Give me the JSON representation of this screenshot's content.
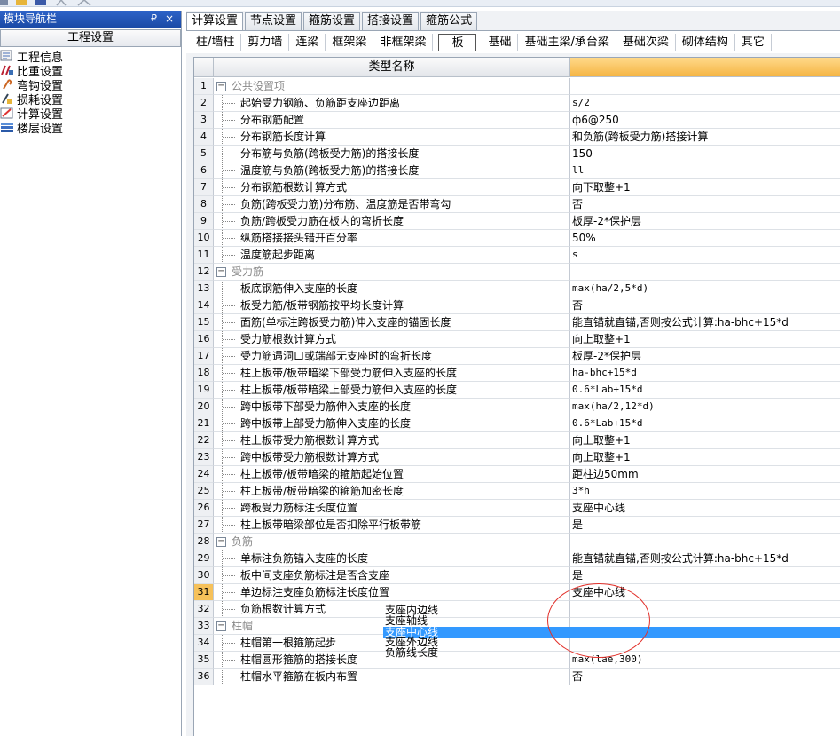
{
  "navigator": {
    "title": "模块导航栏",
    "pin_glyph": "₽",
    "close_glyph": "×",
    "header": "工程设置",
    "items": [
      {
        "label": "工程信息",
        "icon": "info-icon"
      },
      {
        "label": "比重设置",
        "icon": "rebar-icon"
      },
      {
        "label": "弯钩设置",
        "icon": "hook-icon"
      },
      {
        "label": "损耗设置",
        "icon": "loss-icon"
      },
      {
        "label": "计算设置",
        "icon": "calc-icon"
      },
      {
        "label": "楼层设置",
        "icon": "floor-icon"
      }
    ]
  },
  "tabs": [
    "计算设置",
    "节点设置",
    "箍筋设置",
    "搭接设置",
    "箍筋公式"
  ],
  "active_tab": 0,
  "subtabs": [
    "柱/墙柱",
    "剪力墙",
    "连梁",
    "框架梁",
    "非框架梁",
    "板",
    "基础",
    "基础主梁/承台梁",
    "基础次梁",
    "砌体结构",
    "其它"
  ],
  "active_subtab": 5,
  "grid": {
    "header_name": "类型名称",
    "rows": [
      {
        "n": "1",
        "name": "公共设置项",
        "value": "",
        "group": true
      },
      {
        "n": "2",
        "name": "起始受力钢筋、负筋距支座边距离",
        "value": "s/2"
      },
      {
        "n": "3",
        "name": "分布钢筋配置",
        "value": "ф6@250"
      },
      {
        "n": "4",
        "name": "分布钢筋长度计算",
        "value": "和负筋(跨板受力筋)搭接计算"
      },
      {
        "n": "5",
        "name": "分布筋与负筋(跨板受力筋)的搭接长度",
        "value": "150"
      },
      {
        "n": "6",
        "name": "温度筋与负筋(跨板受力筋)的搭接长度",
        "value": "ll"
      },
      {
        "n": "7",
        "name": "分布钢筋根数计算方式",
        "value": "向下取整+1"
      },
      {
        "n": "8",
        "name": "负筋(跨板受力筋)分布筋、温度筋是否带弯勾",
        "value": "否"
      },
      {
        "n": "9",
        "name": "负筋/跨板受力筋在板内的弯折长度",
        "value": "板厚-2*保护层"
      },
      {
        "n": "10",
        "name": "纵筋搭接接头错开百分率",
        "value": "50%"
      },
      {
        "n": "11",
        "name": "温度筋起步距离",
        "value": "s"
      },
      {
        "n": "12",
        "name": "受力筋",
        "value": "",
        "group": true
      },
      {
        "n": "13",
        "name": "板底钢筋伸入支座的长度",
        "value": "max(ha/2,5*d)"
      },
      {
        "n": "14",
        "name": "板受力筋/板带钢筋按平均长度计算",
        "value": "否"
      },
      {
        "n": "15",
        "name": "面筋(单标注跨板受力筋)伸入支座的锚固长度",
        "value": "能直锚就直锚,否则按公式计算:ha-bhc+15*d"
      },
      {
        "n": "16",
        "name": "受力筋根数计算方式",
        "value": "向上取整+1"
      },
      {
        "n": "17",
        "name": "受力筋遇洞口或端部无支座时的弯折长度",
        "value": "板厚-2*保护层"
      },
      {
        "n": "18",
        "name": "柱上板带/板带暗梁下部受力筋伸入支座的长度",
        "value": "ha-bhc+15*d"
      },
      {
        "n": "19",
        "name": "柱上板带/板带暗梁上部受力筋伸入支座的长度",
        "value": "0.6*Lab+15*d"
      },
      {
        "n": "20",
        "name": "跨中板带下部受力筋伸入支座的长度",
        "value": "max(ha/2,12*d)"
      },
      {
        "n": "21",
        "name": "跨中板带上部受力筋伸入支座的长度",
        "value": "0.6*Lab+15*d"
      },
      {
        "n": "22",
        "name": "柱上板带受力筋根数计算方式",
        "value": "向上取整+1"
      },
      {
        "n": "23",
        "name": "跨中板带受力筋根数计算方式",
        "value": "向上取整+1"
      },
      {
        "n": "24",
        "name": "柱上板带/板带暗梁的箍筋起始位置",
        "value": "距柱边50mm"
      },
      {
        "n": "25",
        "name": "柱上板带/板带暗梁的箍筋加密长度",
        "value": "3*h"
      },
      {
        "n": "26",
        "name": "跨板受力筋标注长度位置",
        "value": "支座中心线"
      },
      {
        "n": "27",
        "name": "柱上板带暗梁部位是否扣除平行板带筋",
        "value": "是"
      },
      {
        "n": "28",
        "name": "负筋",
        "value": "",
        "group": true
      },
      {
        "n": "29",
        "name": "单标注负筋锚入支座的长度",
        "value": "能直锚就直锚,否则按公式计算:ha-bhc+15*d"
      },
      {
        "n": "30",
        "name": "板中间支座负筋标注是否含支座",
        "value": "是"
      },
      {
        "n": "31",
        "name": "单边标注支座负筋标注长度位置",
        "value": "支座中心线",
        "selected": true
      },
      {
        "n": "32",
        "name": "负筋根数计算方式",
        "value": ""
      },
      {
        "n": "33",
        "name": "柱帽",
        "value": "",
        "group": true
      },
      {
        "n": "34",
        "name": "柱帽第一根箍筋起步",
        "value": ""
      },
      {
        "n": "35",
        "name": "柱帽圆形箍筋的搭接长度",
        "value": "max(lae,300)"
      },
      {
        "n": "36",
        "name": "柱帽水平箍筋在板内布置",
        "value": "否"
      }
    ]
  },
  "dropdown": {
    "options": [
      "支座内边线",
      "支座轴线",
      "支座中心线",
      "支座外边线",
      "负筋线长度"
    ],
    "selected": 2
  }
}
